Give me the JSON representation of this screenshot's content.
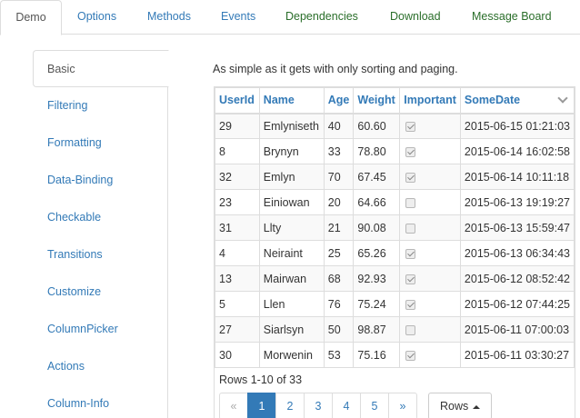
{
  "tabs": [
    {
      "label": "Demo"
    },
    {
      "label": "Options"
    },
    {
      "label": "Methods"
    },
    {
      "label": "Events"
    },
    {
      "label": "Dependencies"
    },
    {
      "label": "Download"
    },
    {
      "label": "Message Board"
    }
  ],
  "sidebar": {
    "items": [
      {
        "label": "Basic"
      },
      {
        "label": "Filtering"
      },
      {
        "label": "Formatting"
      },
      {
        "label": "Data-Binding"
      },
      {
        "label": "Checkable"
      },
      {
        "label": "Transitions"
      },
      {
        "label": "Customize"
      },
      {
        "label": "ColumnPicker"
      },
      {
        "label": "Actions"
      },
      {
        "label": "Column-Info"
      }
    ]
  },
  "intro": "As simple as it gets with only sorting and paging.",
  "table": {
    "headers": [
      "UserId",
      "Name",
      "Age",
      "Weight",
      "Important",
      "SomeDate"
    ],
    "rows": [
      {
        "id": "29",
        "name": "Emlyniseth",
        "age": "40",
        "weight": "60.60",
        "important": true,
        "date": "2015-06-15 01:21:03"
      },
      {
        "id": "8",
        "name": "Brynyn",
        "age": "33",
        "weight": "78.80",
        "important": true,
        "date": "2015-06-14 16:02:58"
      },
      {
        "id": "32",
        "name": "Emlyn",
        "age": "70",
        "weight": "67.45",
        "important": true,
        "date": "2015-06-14 10:11:18"
      },
      {
        "id": "23",
        "name": "Einiowan",
        "age": "20",
        "weight": "64.66",
        "important": false,
        "date": "2015-06-13 19:19:27"
      },
      {
        "id": "31",
        "name": "Llty",
        "age": "21",
        "weight": "90.08",
        "important": false,
        "date": "2015-06-13 15:59:47"
      },
      {
        "id": "4",
        "name": "Neiraint",
        "age": "25",
        "weight": "65.26",
        "important": true,
        "date": "2015-06-13 06:34:43"
      },
      {
        "id": "13",
        "name": "Mairwan",
        "age": "68",
        "weight": "92.93",
        "important": true,
        "date": "2015-06-12 08:52:42"
      },
      {
        "id": "5",
        "name": "Llen",
        "age": "76",
        "weight": "75.24",
        "important": true,
        "date": "2015-06-12 07:44:25"
      },
      {
        "id": "27",
        "name": "Siarlsyn",
        "age": "50",
        "weight": "98.87",
        "important": false,
        "date": "2015-06-11 07:00:03"
      },
      {
        "id": "30",
        "name": "Morwenin",
        "age": "53",
        "weight": "75.16",
        "important": true,
        "date": "2015-06-11 03:30:27"
      }
    ]
  },
  "footer": {
    "rowinfo": "Rows 1-10 of 33",
    "pages": [
      "«",
      "1",
      "2",
      "3",
      "4",
      "5",
      "»"
    ],
    "rows_button": "Rows"
  }
}
